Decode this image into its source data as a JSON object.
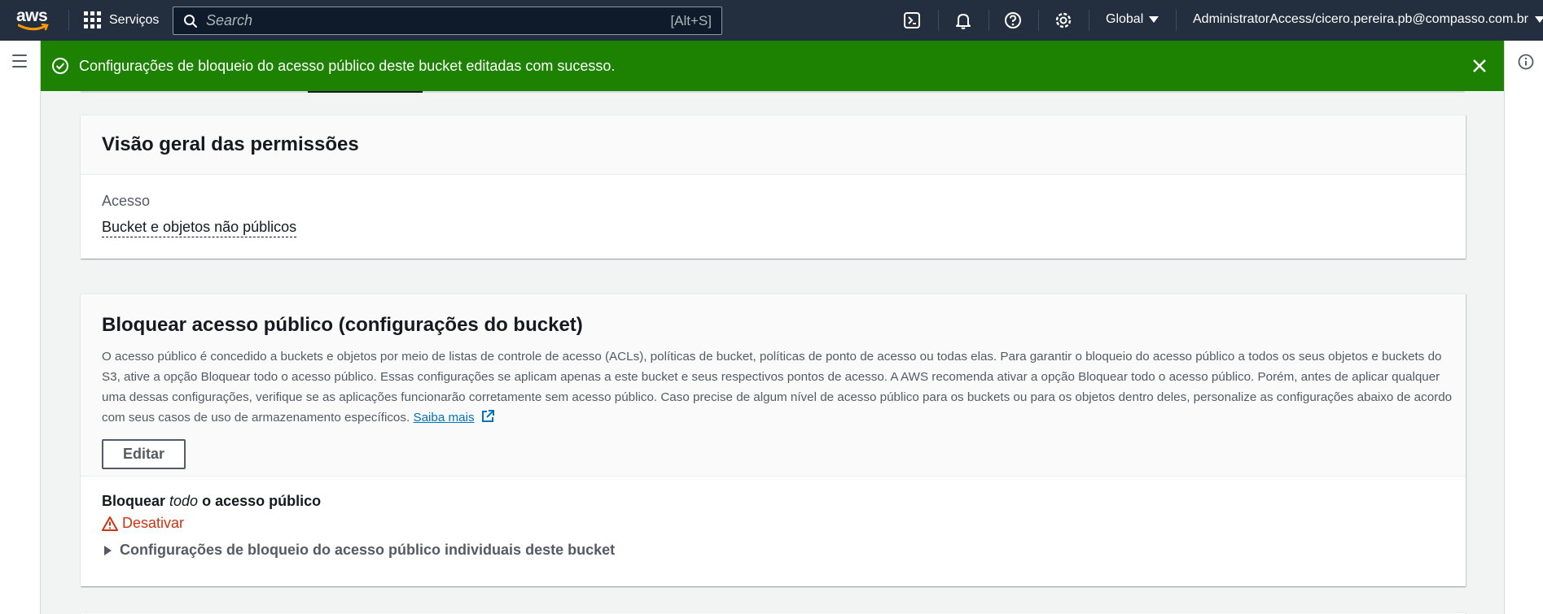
{
  "nav": {
    "logo_text": "aws",
    "services_label": "Serviços",
    "search_placeholder": "Search",
    "search_shortcut": "[Alt+S]",
    "region": "Global",
    "account": "AdministratorAccess/cicero.pereira.pb@compasso.com.br",
    "icons": [
      "cloudshell-icon",
      "notifications-icon",
      "help-icon",
      "settings-icon"
    ]
  },
  "flash": {
    "message": "Configurações de bloqueio do acesso público deste bucket editadas com sucesso.",
    "color": "#1d8102"
  },
  "permissions_overview": {
    "title": "Visão geral das permissões",
    "access_label": "Acesso",
    "access_value": "Bucket e objetos não públicos"
  },
  "block_public_access": {
    "title": "Bloquear acesso público (configurações do bucket)",
    "description": "O acesso público é concedido a buckets e objetos por meio de listas de controle de acesso (ACLs), políticas de bucket, políticas de ponto de acesso ou todas elas. Para garantir o bloqueio do acesso público a todos os seus objetos e buckets do S3, ative a opção Bloquear todo o acesso público. Essas configurações se aplicam apenas a este bucket e seus respectivos pontos de acesso. A AWS recomenda ativar a opção Bloquear todo o acesso público. Porém, antes de aplicar qualquer uma dessas configurações, verifique se as aplicações funcionarão corretamente sem acesso público. Caso precise de algum nível de acesso público para os buckets ou para os objetos dentro deles, personalize as configurações abaixo de acordo com seus casos de uso de armazenamento específicos.",
    "learn_more": "Saiba mais",
    "edit_button": "Editar",
    "block_all_prefix": "Bloquear",
    "block_all_italic": "todo",
    "block_all_suffix": "o acesso público",
    "status": "Desativar",
    "status_color": "#d13212",
    "expander_label": "Configurações de bloqueio do acesso público individuais deste bucket"
  }
}
